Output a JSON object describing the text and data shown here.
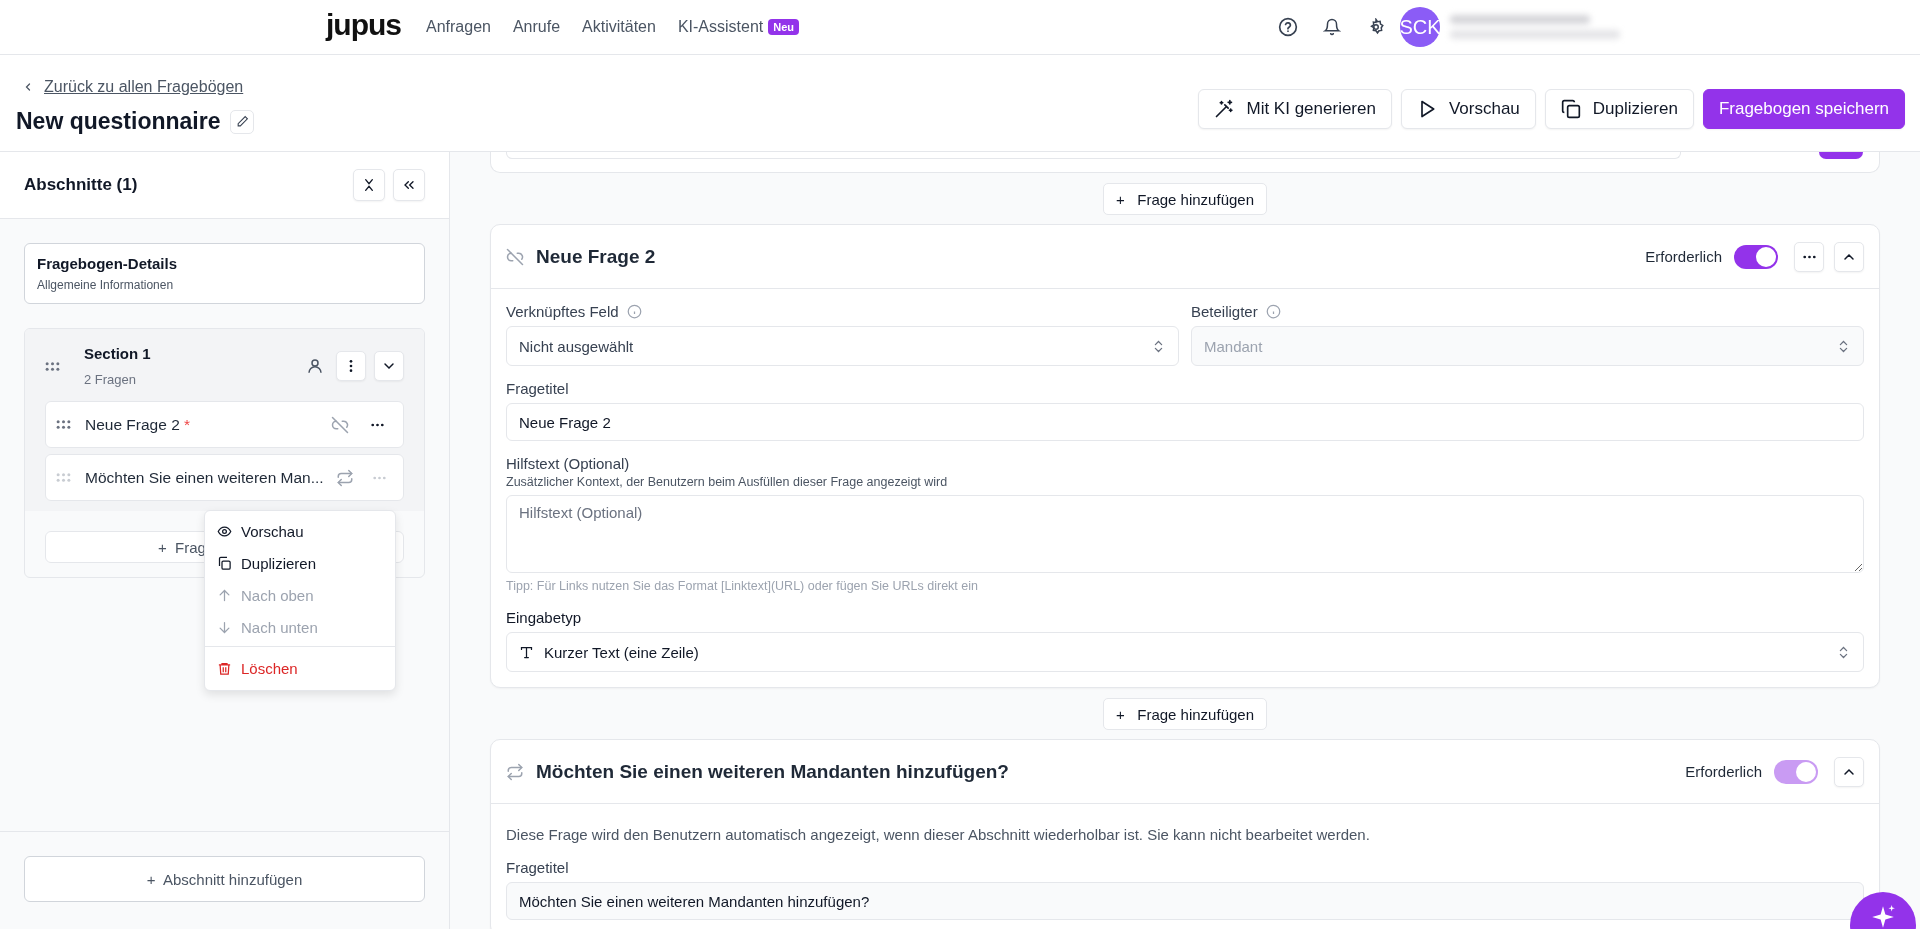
{
  "nav": {
    "logo": "jupus",
    "links": [
      {
        "label": "Anfragen"
      },
      {
        "label": "Anrufe"
      },
      {
        "label": "Aktivitäten"
      },
      {
        "label": "KI-Assistent",
        "badge": "Neu"
      }
    ],
    "avatar": "SCK"
  },
  "header": {
    "back_link": "Zurück zu allen Fragebögen",
    "title": "New questionnaire",
    "actions": [
      {
        "label": "Mit KI generieren",
        "kind": "ai"
      },
      {
        "label": "Vorschau",
        "kind": "preview"
      },
      {
        "label": "Duplizieren",
        "kind": "duplicate"
      },
      {
        "label": "Fragebogen speichern",
        "kind": "primary"
      }
    ]
  },
  "sidebar": {
    "title": "Abschnitte (1)",
    "details": {
      "title": "Fragebogen-Details",
      "subtitle": "Allgemeine Informationen"
    },
    "section": {
      "title": "Section 1",
      "subtitle": "2 Fragen",
      "expanded": true,
      "add_button": "+  Frag",
      "required_mark": "*",
      "questions": [
        {
          "title": "Neue Frage 2",
          "required": true,
          "kind": "unlinked",
          "disabled": false
        },
        {
          "title": "Möchten Sie einen weiteren Man...",
          "required": false,
          "kind": "repeat",
          "disabled": true
        }
      ]
    },
    "add_section": "+  Abschnitt hinzufügen"
  },
  "context_menu": {
    "items": [
      {
        "label": "Vorschau",
        "kind": "eye",
        "disabled": false
      },
      {
        "label": "Duplizieren",
        "kind": "copy",
        "disabled": false
      },
      {
        "label": "Nach oben",
        "kind": "up",
        "disabled": true
      },
      {
        "label": "Nach unten",
        "kind": "down",
        "disabled": true
      },
      {
        "label": "Löschen",
        "kind": "delete",
        "disabled": false
      }
    ]
  },
  "main": {
    "previous_question": {
      "required": true
    },
    "add_buttons": [
      "+   Frage hinzufügen",
      "+   Frage hinzufügen"
    ],
    "question": {
      "kind": "unlinked",
      "title": "Neue Frage 2",
      "required_label": "Erforderlich",
      "required": true,
      "expanded": true,
      "linked_field": {
        "label": "Verknüpftes Feld",
        "value": "Nicht ausgewählt",
        "disabled": false
      },
      "participant": {
        "label": "Beteiligter",
        "value": "Mandant",
        "disabled": true
      },
      "title_field": {
        "label": "Fragetitel",
        "value": "Neue Frage 2"
      },
      "help_field": {
        "label": "Hilfstext (Optional)",
        "description": "Zusätzlicher Kontext, der Benutzern beim Ausfüllen dieser Frage angezeigt wird",
        "placeholder": "Hilfstext (Optional)",
        "tip": "Tipp: Für Links nutzen Sie das Format [Linktext](URL) oder fügen Sie URLs direkt ein"
      },
      "input_type": {
        "label": "Eingabetyp",
        "value": "Kurzer Text (eine Zeile)"
      }
    },
    "repeat_question": {
      "kind": "repeat",
      "title": "Möchten Sie einen weiteren Mandanten hinzufügen?",
      "required_label": "Erforderlich",
      "required": true,
      "disabled": true,
      "expanded": true,
      "notice": "Diese Frage wird den Benutzern automatisch angezeigt, wenn dieser Abschnitt wiederholbar ist. Sie kann nicht bearbeitet werden.",
      "title_field": {
        "label": "Fragetitel",
        "value": "Möchten Sie einen weiteren Mandanten hinzufügen?"
      }
    }
  }
}
